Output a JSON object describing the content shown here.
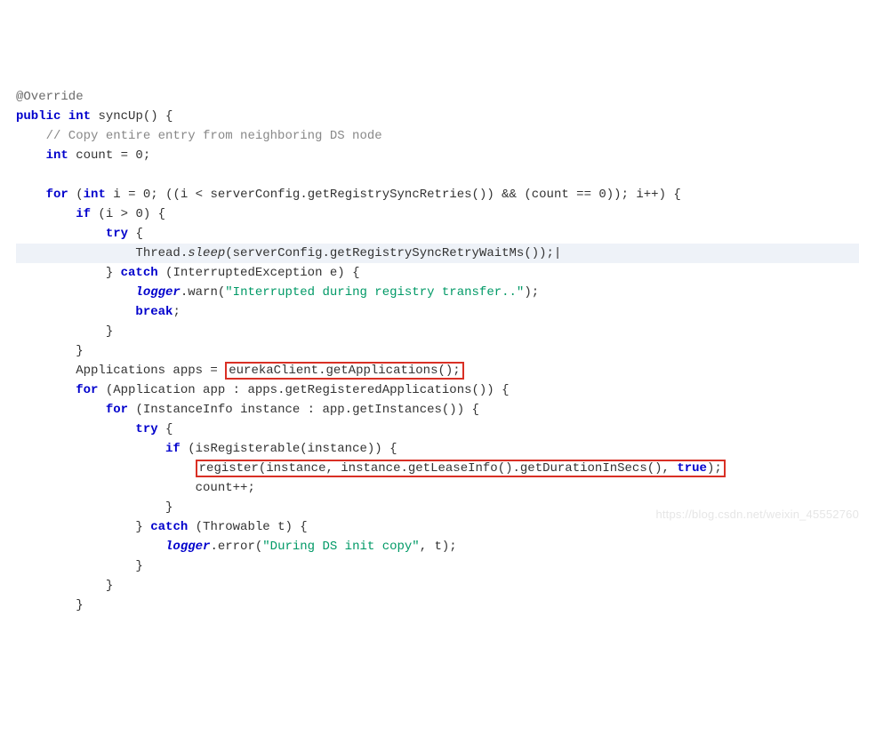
{
  "code": {
    "l01_ann": "@Override",
    "l02_kw_public": "public",
    "l02_kw_int": "int",
    "l02_fn": " syncUp() {",
    "l03_cmt": "    // Copy entire entry from neighboring DS node",
    "l04_kw_int": "    int",
    "l04_rest": " count = 0;",
    "l05": "",
    "l06_a": "    ",
    "l06_kw_for": "for",
    "l06_b": " (",
    "l06_kw_int": "int",
    "l06_c": " i = 0; ((i < ",
    "l06_ref": "serverConfig",
    "l06_d": ".getRegistrySyncRetries()) && (count == 0)); i++) {",
    "l07_a": "        ",
    "l07_kw_if": "if",
    "l07_b": " (i > 0) {",
    "l08_a": "            ",
    "l08_kw_try": "try",
    "l08_b": " {",
    "l09_a": "                Thread.",
    "l09_sleep": "sleep",
    "l09_b": "(",
    "l09_ref": "serverConfig",
    "l09_c": ".getRegistrySyncRetryWaitMs());|",
    "l10_a": "            } ",
    "l10_kw_catch": "catch",
    "l10_b": " (InterruptedException e) {",
    "l11_a": "                ",
    "l11_logger": "logger",
    "l11_b": ".warn(",
    "l11_str": "\"Interrupted during registry transfer..\"",
    "l11_c": ");",
    "l12_a": "                ",
    "l12_kw_break": "break",
    "l12_b": ";",
    "l13": "            }",
    "l14": "        }",
    "l15_a": "        Applications apps = ",
    "l15_box": "eurekaClient.getApplications();",
    "l16_a": "        ",
    "l16_kw_for": "for",
    "l16_b": " (Application app : apps.getRegisteredApplications()) {",
    "l17_a": "            ",
    "l17_kw_for": "for",
    "l17_b": " (InstanceInfo instance : app.getInstances()) {",
    "l18_a": "                ",
    "l18_kw_try": "try",
    "l18_b": " {",
    "l19_a": "                    ",
    "l19_kw_if": "if",
    "l19_b": " (isRegisterable(instance)) {",
    "l20_a": "                        ",
    "l20_box_a": "register(instance, instance.getLeaseInfo().getDurationInSecs(), ",
    "l20_box_kw": "true",
    "l20_box_b": ");",
    "l21": "                        count++;",
    "l22": "                    }",
    "l23_a": "                } ",
    "l23_kw_catch": "catch",
    "l23_b": " (Throwable t) {",
    "l24_a": "                    ",
    "l24_logger": "logger",
    "l24_b": ".error(",
    "l24_str": "\"During DS init copy\"",
    "l24_c": ", t);",
    "l25": "                }",
    "l26": "            }",
    "l27": "        }"
  },
  "watermark": "https://blog.csdn.net/weixin_45552760"
}
